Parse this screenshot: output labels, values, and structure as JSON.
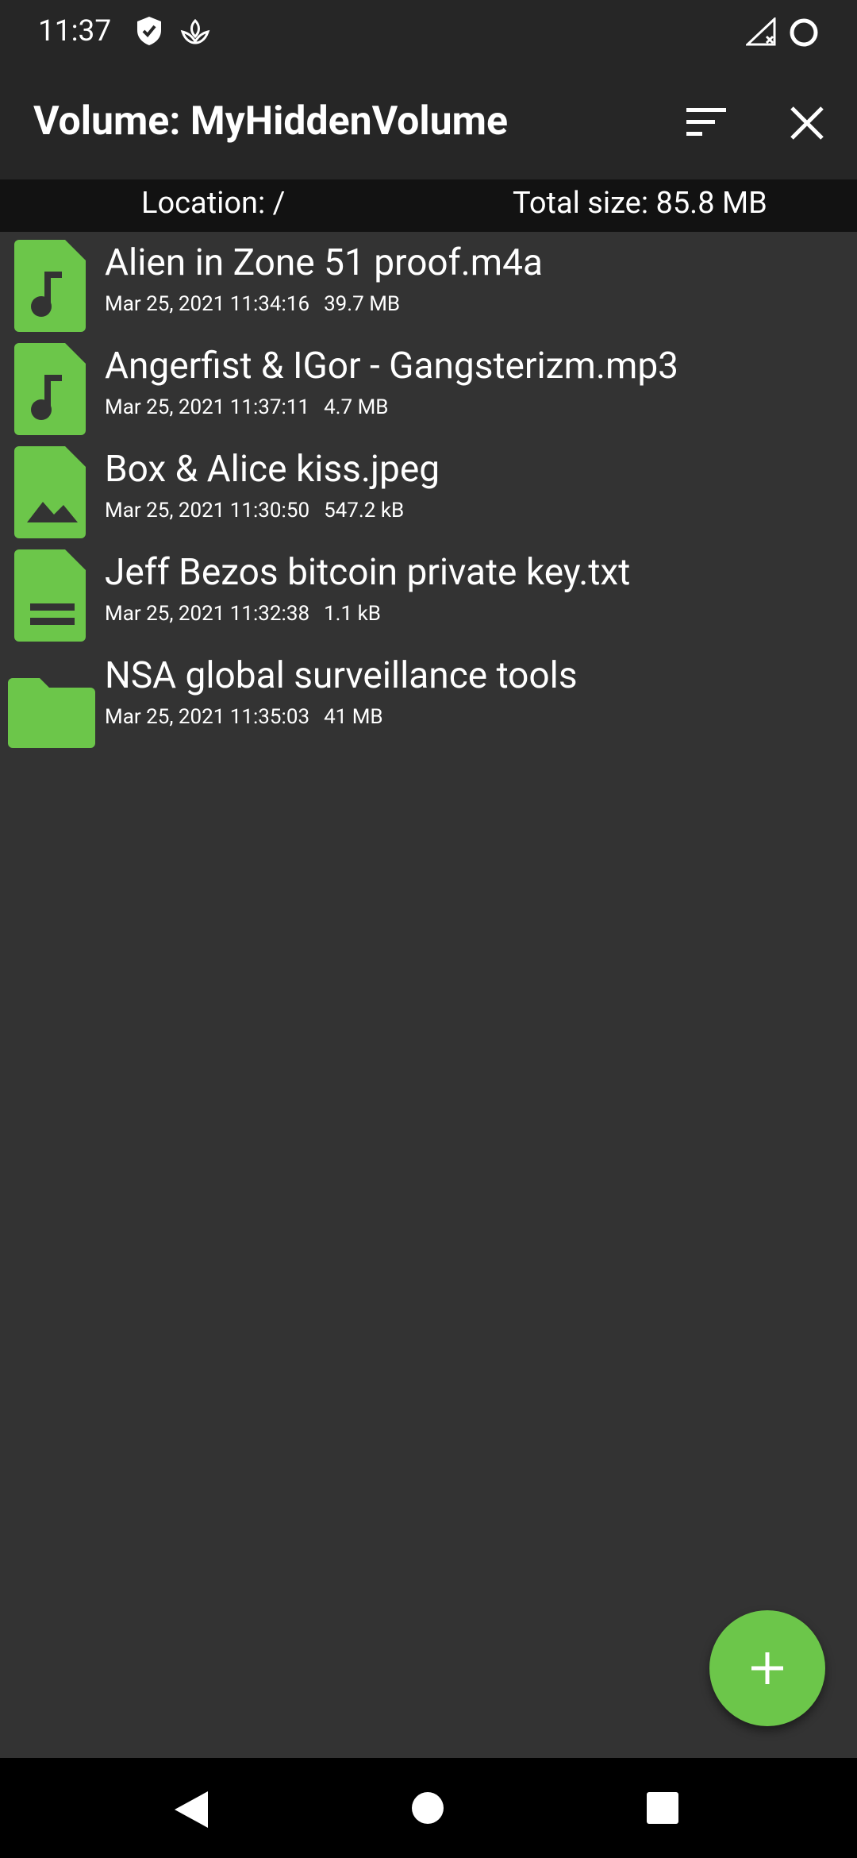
{
  "status_bar": {
    "time": "11:37",
    "icons": [
      "shield-icon",
      "leaf-icon",
      "signal-off-icon",
      "circle-icon"
    ]
  },
  "app_bar": {
    "title": "Volume: MyHiddenVolume",
    "actions": [
      "sort-icon",
      "close-icon"
    ]
  },
  "info_bar": {
    "location": "Location: /",
    "total_size": "Total size: 85.8 MB"
  },
  "files": [
    {
      "name": "Alien in Zone 51 proof.m4a",
      "date": "Mar 25, 2021 11:34:16",
      "size": "39.7 MB",
      "icon": "audio-file-icon"
    },
    {
      "name": "Angerfist & IGor - Gangsterizm.mp3",
      "date": "Mar 25, 2021 11:37:11",
      "size": "4.7 MB",
      "icon": "audio-file-icon"
    },
    {
      "name": "Box & Alice kiss.jpeg",
      "date": "Mar 25, 2021 11:30:50",
      "size": "547.2 kB",
      "icon": "image-file-icon"
    },
    {
      "name": "Jeff Bezos bitcoin private key.txt",
      "date": "Mar 25, 2021 11:32:38",
      "size": "1.1 kB",
      "icon": "text-file-icon"
    },
    {
      "name": "NSA global surveillance tools",
      "date": "Mar 25, 2021 11:35:03",
      "size": "41 MB",
      "icon": "folder-icon"
    }
  ],
  "fab": {
    "icon": "plus-icon"
  },
  "colors": {
    "accent": "#6cc64a",
    "background": "#333333",
    "bar": "#262626",
    "info_bar": "#121212",
    "nav_bar": "#000000"
  }
}
